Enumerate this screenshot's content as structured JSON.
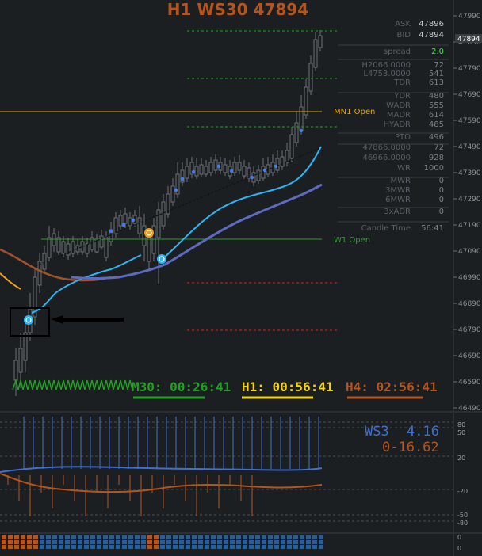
{
  "header": {
    "title": "H1 WS30 47894"
  },
  "price_axis": {
    "labels": [
      "47990",
      "47890",
      "47790",
      "47690",
      "47590",
      "47490",
      "47390",
      "47290",
      "47190",
      "47090",
      "46990",
      "46890",
      "46790",
      "46690",
      "46590",
      "46490"
    ],
    "current_price_tag": "47894"
  },
  "info_panel": {
    "rows": [
      {
        "label": "ASK",
        "value": "47896"
      },
      {
        "label": "BID",
        "value": "47894"
      },
      {
        "label": "spread",
        "value": "2.0"
      },
      {
        "label": "H2066.0000",
        "value": "72"
      },
      {
        "label": "L4753.0000",
        "value": "541"
      },
      {
        "label": "TDR",
        "value": "613"
      },
      {
        "label": "YDR",
        "value": "480"
      },
      {
        "label": "WADR",
        "value": "555"
      },
      {
        "label": "MADR",
        "value": "614"
      },
      {
        "label": "HYADR",
        "value": "485"
      },
      {
        "label": "PTO",
        "value": "496"
      },
      {
        "label": "47866.0000",
        "value": "72"
      },
      {
        "label": "46966.0000",
        "value": "928"
      },
      {
        "label": "WR",
        "value": "1000"
      },
      {
        "label": "MWR",
        "value": "0"
      },
      {
        "label": "3MWR",
        "value": "0"
      },
      {
        "label": "6MWR",
        "value": "0"
      },
      {
        "label": "3xADR",
        "value": "0"
      },
      {
        "label": "Candle Time",
        "value": "56:41"
      }
    ]
  },
  "levels": {
    "mn1_label": "MN1 Open",
    "w1_label": "W1 Open"
  },
  "timers": {
    "m30": "M30: 00:26:41",
    "h1": "H1: 00:56:41",
    "h4": "H4: 02:56:41"
  },
  "indicator": {
    "label_blue": "WS3",
    "value_blue": "4.16",
    "value_orange": "0-16.62",
    "axis_labels": [
      "80",
      "50",
      "20",
      "-20",
      "-50",
      "-80"
    ],
    "bottom_labels": [
      "0",
      "0"
    ]
  },
  "colors": {
    "background": "#1c1f22",
    "bull_candle": "#6b7076",
    "ema_fast": "#29b6f6",
    "ema_slow": "#5c6bc0",
    "ema_brown": "#a0522d",
    "title": "#b5541c",
    "mn1_line": "#e6a800",
    "w1_line": "#2e9e2e",
    "m30": "#1fa31f",
    "h1": "#f5d50a",
    "h4": "#b5541c",
    "indicator_blue": "#3f6fd0",
    "indicator_orange": "#b5541c"
  }
}
